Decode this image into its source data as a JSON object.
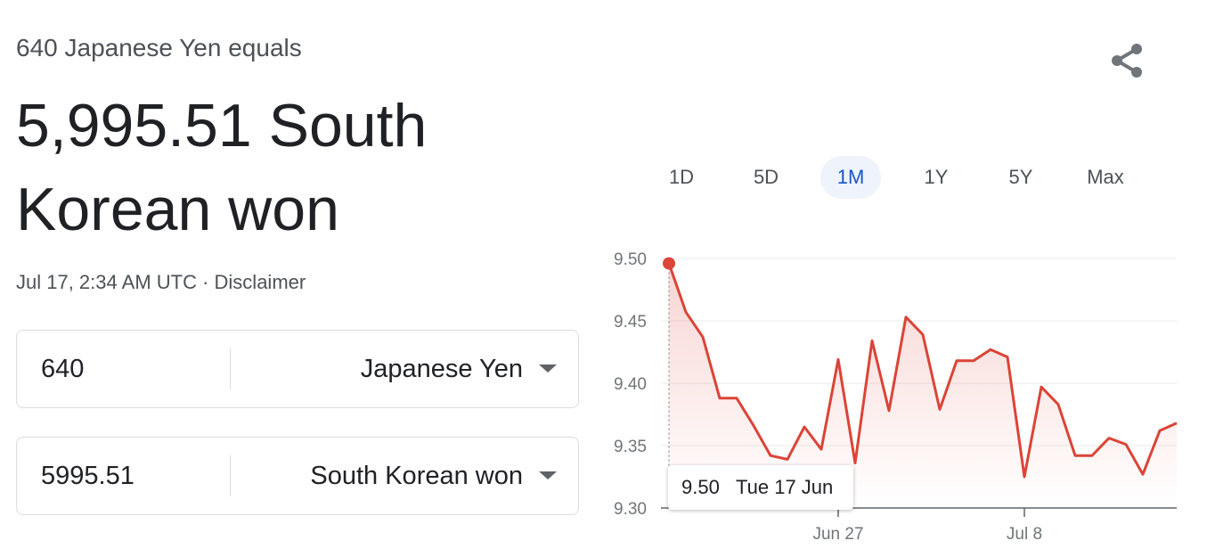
{
  "header": {
    "subtitle": "640 Japanese Yen equals",
    "result": "5,995.51 South Korean won",
    "timestamp": "Jul 17, 2:34 AM UTC · ",
    "disclaimer": "Disclaimer"
  },
  "converter": {
    "from": {
      "value": "640",
      "currency": "Japanese Yen"
    },
    "to": {
      "value": "5995.51",
      "currency": "South Korean won"
    }
  },
  "share_icon": "share-icon",
  "tabs": [
    {
      "label": "1D",
      "active": false
    },
    {
      "label": "5D",
      "active": false
    },
    {
      "label": "1M",
      "active": true
    },
    {
      "label": "1Y",
      "active": false
    },
    {
      "label": "5Y",
      "active": false
    },
    {
      "label": "Max",
      "active": false
    }
  ],
  "colors": {
    "line": "#db4437",
    "active_tab_text": "#1a56c8",
    "active_tab_bg": "#eef3fc"
  },
  "tooltip": {
    "value": "9.50",
    "date": "Tue 17 Jun"
  },
  "chart_data": {
    "type": "area",
    "series": [
      {
        "values": [
          9.496,
          9.457,
          9.437,
          9.388,
          9.388,
          9.366,
          9.342,
          9.339,
          9.365,
          9.347,
          9.419,
          9.336,
          9.434,
          9.378,
          9.453,
          9.439,
          9.379,
          9.418,
          9.418,
          9.427,
          9.421,
          9.325,
          9.397,
          9.383,
          9.342,
          9.342,
          9.356,
          9.351,
          9.327,
          9.362,
          9.368
        ]
      }
    ],
    "ylim": [
      9.3,
      9.5
    ],
    "yticks": [
      "9.50",
      "9.45",
      "9.40",
      "9.35",
      "9.30"
    ],
    "xticks": [
      {
        "label": "Jun 27",
        "index": 10
      },
      {
        "label": "Jul 8",
        "index": 21
      }
    ],
    "grid": true,
    "highlight_index": 0
  }
}
